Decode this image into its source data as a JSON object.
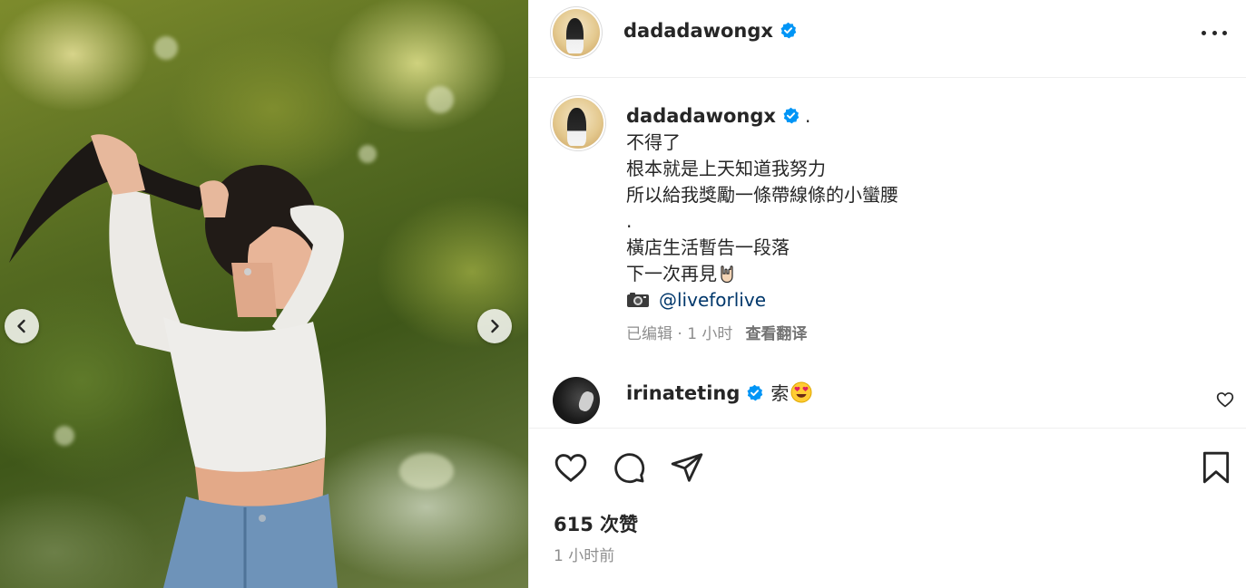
{
  "post": {
    "username": "dadadawongx",
    "verified": true,
    "more_icon": "more-horizontal-icon"
  },
  "caption": {
    "username": "dadadawongx",
    "dot": ".",
    "lines": [
      "不得了",
      "根本就是上天知道我努力",
      "所以給我獎勵一條帶線條的小蠻腰",
      ".",
      "橫店生活暫告一段落",
      "下一次再見"
    ],
    "hand_emoji": "rock-on-hand-icon",
    "camera_emoji": "camera-icon",
    "mention": "@liveforlive",
    "meta_time": "已编辑 · 1 小时",
    "translate_label": "查看翻译"
  },
  "comment": {
    "username": "irinateting",
    "text": "索",
    "emoji": "heart-eyes-icon"
  },
  "stats": {
    "likes": "615 次赞",
    "posted_time": "1 小时前"
  },
  "colors": {
    "text": "#262626",
    "secondary": "#8e8e8e",
    "verified_blue": "#0095f6",
    "mention": "#00376b",
    "border": "#efefef"
  }
}
